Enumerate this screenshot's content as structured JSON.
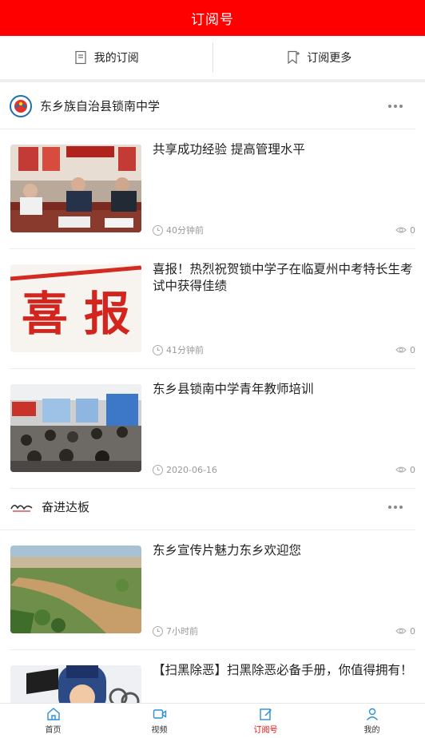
{
  "header": {
    "title": "订阅号"
  },
  "subtabs": [
    {
      "label": "我的订阅",
      "icon": "bookmark-list-icon"
    },
    {
      "label": "订阅更多",
      "icon": "bookmark-add-icon"
    }
  ],
  "channels": [
    {
      "name": "东乡族自治县锁南中学",
      "articles": [
        {
          "title": "共享成功经验  提高管理水平",
          "time": "40分钟前",
          "views": "0",
          "image": "meeting-photo"
        },
        {
          "title": "喜报！热烈祝贺锁中学子在临夏州中考特长生考试中获得佳绩",
          "time": "41分钟前",
          "views": "0",
          "image": "good-news-banner",
          "banner_text": "喜 报"
        },
        {
          "title": "东乡县锁南中学青年教师培训",
          "time": "2020-06-16",
          "views": "0",
          "image": "classroom-photo"
        }
      ]
    },
    {
      "name": "奋进达板",
      "articles": [
        {
          "title": "东乡宣传片魅力东乡欢迎您",
          "time": "7小时前",
          "views": "0",
          "image": "river-landscape-photo"
        },
        {
          "title": "【扫黑除恶】扫黑除恶必备手册，你值得拥有！",
          "time": "",
          "views": "",
          "image": "cartoon-police-illustration"
        }
      ]
    }
  ],
  "bottom_nav": [
    {
      "label": "首页",
      "icon": "home-icon",
      "active": false
    },
    {
      "label": "视频",
      "icon": "video-icon",
      "active": false
    },
    {
      "label": "订阅号",
      "icon": "edit-icon",
      "active": true
    },
    {
      "label": "我的",
      "icon": "user-icon",
      "active": false
    }
  ],
  "colors": {
    "brand_red": "#ff0000",
    "active_nav": "#ee0000"
  }
}
